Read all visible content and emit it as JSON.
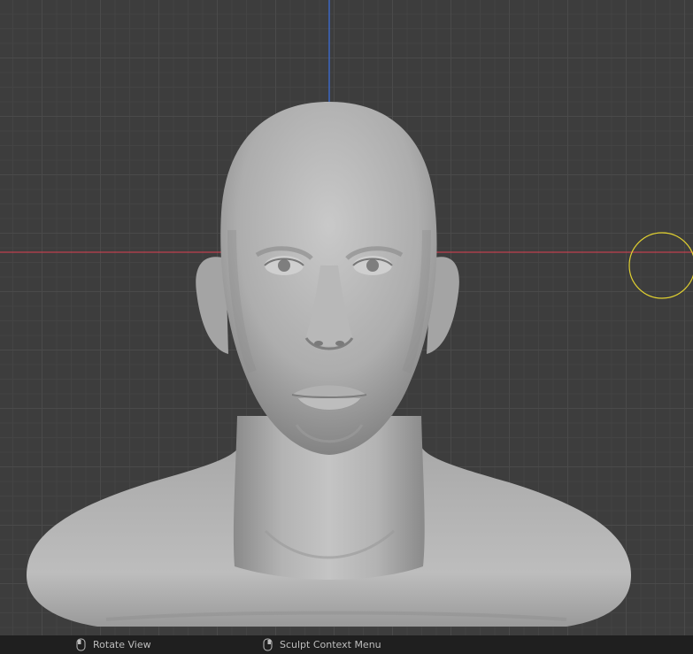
{
  "viewport": {
    "mode": "sculpt",
    "axis_colors": {
      "x_axis": "#c0404e",
      "z_axis": "#3b66c4",
      "brush_cursor": "#e0d030"
    },
    "model": "head-bust-mesh"
  },
  "statusbar": {
    "hints": [
      {
        "icon": "mouse-left-icon",
        "label": "Rotate View"
      },
      {
        "icon": "mouse-right-icon",
        "label": "Sculpt Context Menu"
      }
    ]
  }
}
